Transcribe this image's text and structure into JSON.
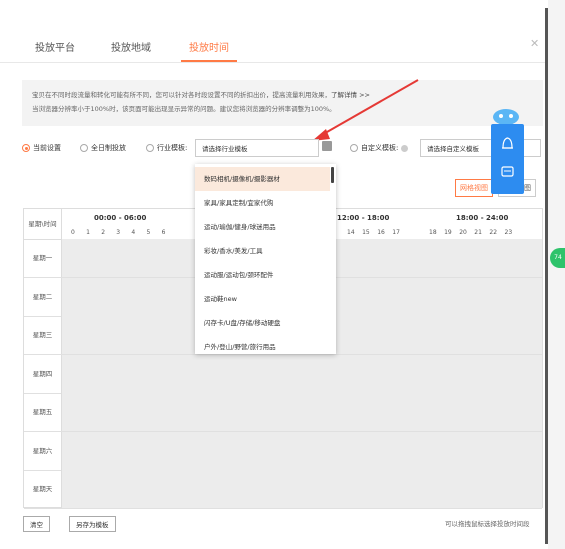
{
  "tabs": [
    {
      "label": "投放平台",
      "active": false
    },
    {
      "label": "投放地域",
      "active": false
    },
    {
      "label": "投放时间",
      "active": true
    }
  ],
  "close_icon": "close-icon",
  "notice": {
    "line1": "宝贝在不同时段流量和转化可能有所不同，您可以针对各时段设置不同的折扣出价，提高流量利用效果，",
    "link": "了解详情 >>",
    "line2": "当浏览器分辨率小于100%时，该页面可能出现显示异常的问题。建议您将浏览器的分辨率调整为100%。"
  },
  "radios": [
    {
      "label": "当前设置",
      "checked": true
    },
    {
      "label": "全日制投放",
      "checked": false
    },
    {
      "label": "行业模板:",
      "checked": false
    }
  ],
  "industry_select": {
    "placeholder": "请选择行业模板"
  },
  "custom_radio": {
    "label": "自定义模板:",
    "checked": false
  },
  "custom_select": {
    "placeholder": "请选择自定义模板"
  },
  "view_buttons": [
    "网格视图",
    "列表视图"
  ],
  "grid": {
    "corner": "星期\\时间",
    "slots": [
      "00:00 - 06:00",
      "06:00 - 12:00",
      "12:00 - 18:00",
      "18:00 - 24:00"
    ],
    "hours_left": [
      "0",
      "1",
      "2",
      "3",
      "4",
      "5",
      "6"
    ],
    "hours_right_a": [
      "14",
      "15",
      "16",
      "17"
    ],
    "hours_right_b": [
      "18",
      "19",
      "20",
      "21",
      "22",
      "23"
    ],
    "days": [
      "星期一",
      "星期二",
      "星期三",
      "星期四",
      "星期五",
      "星期六",
      "星期天"
    ]
  },
  "dropdown": {
    "items": [
      "数码相机/摄像机/摄影器材",
      "家具/家具定制/宜家代购",
      "运动/瑜伽/健身/球迷用品",
      "彩妆/香水/美发/工具",
      "运动服/运动包/颈环配件",
      "运动鞋new",
      "闪存卡/U盘/存储/移动硬盘",
      "户外/登山/野营/旅行用品"
    ],
    "active_index": 0
  },
  "float_panel": {
    "icons": [
      "bell-icon",
      "message-icon"
    ]
  },
  "side_badge": "74",
  "footer": {
    "clear": "清空",
    "save_as": "另存为模板",
    "note": "可以拖拽鼠标选择投放时间段"
  },
  "colors": {
    "accent": "#ff7a45",
    "panel_blue": "#2d8cf0",
    "arrow_red": "#e53935"
  }
}
